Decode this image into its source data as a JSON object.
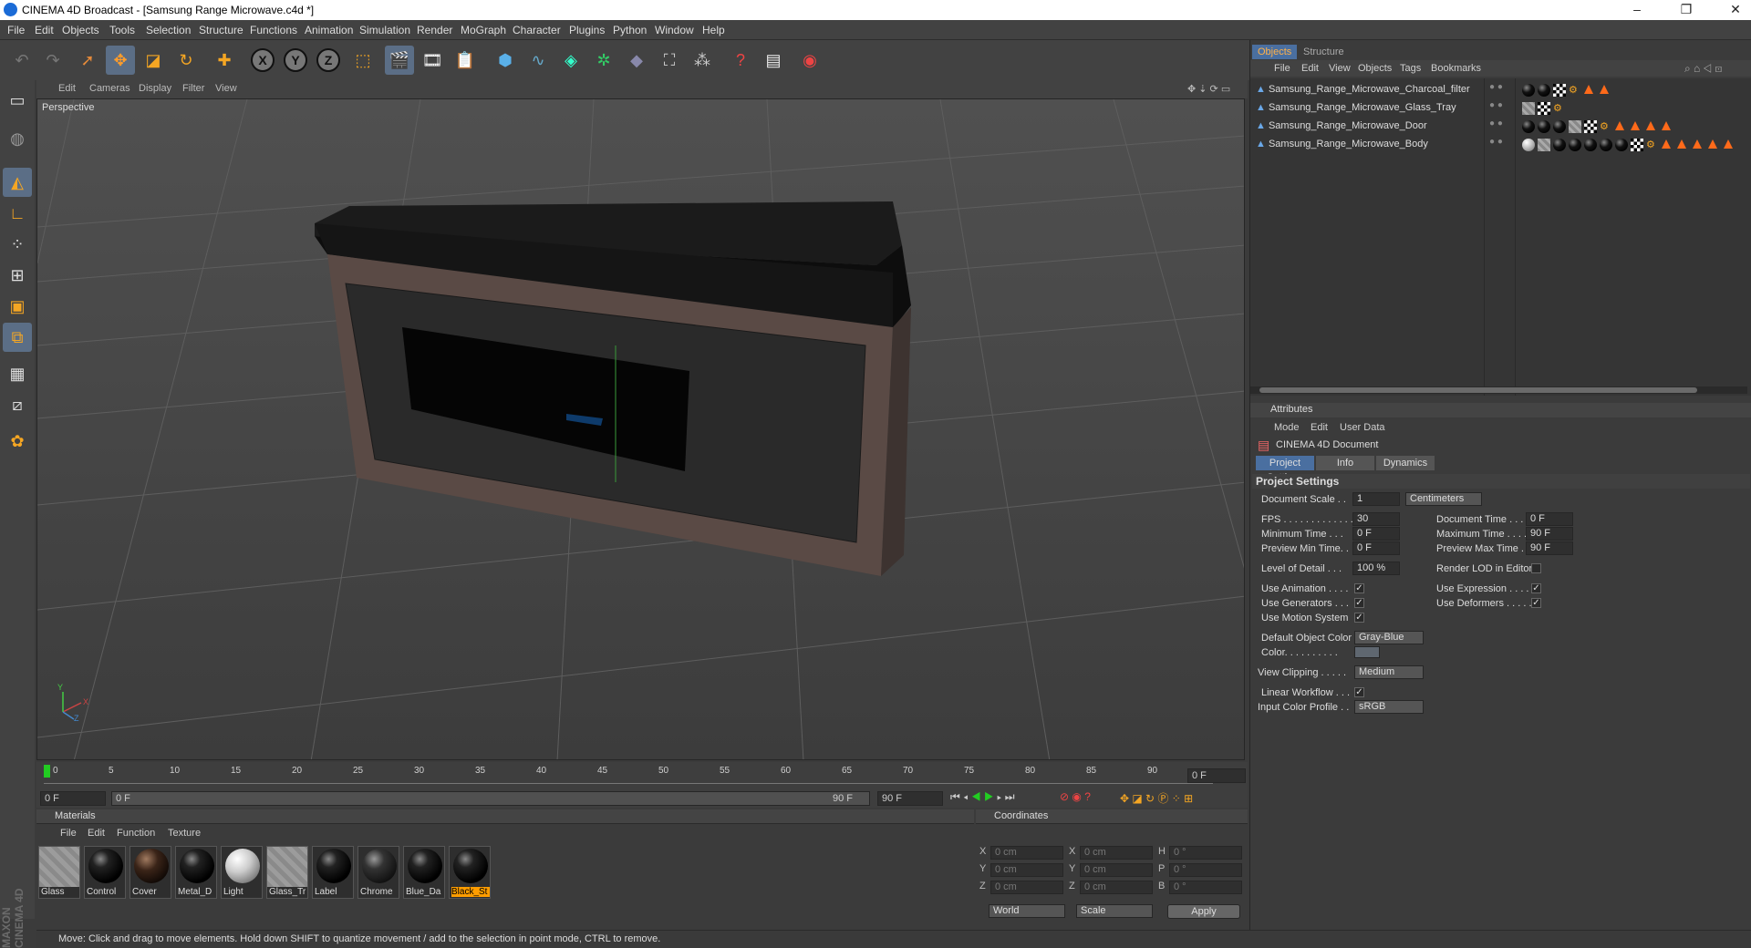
{
  "window": {
    "title": "CINEMA 4D Broadcast - [Samsung Range Microwave.c4d *]"
  },
  "menu": [
    "File",
    "Edit",
    "Objects",
    "Tools",
    "Selection",
    "Structure",
    "Functions",
    "Animation",
    "Simulation",
    "Render",
    "MoGraph",
    "Character",
    "Plugins",
    "Python",
    "Window",
    "Help"
  ],
  "viewport": {
    "menu": [
      "Edit",
      "Cameras",
      "Display",
      "Filter",
      "View"
    ],
    "label": "Perspective",
    "axis": {
      "x": "X",
      "y": "Y",
      "z": "Z"
    }
  },
  "timeline": {
    "ticks": [
      "0",
      "5",
      "10",
      "15",
      "20",
      "25",
      "30",
      "35",
      "40",
      "45",
      "50",
      "55",
      "60",
      "65",
      "70",
      "75",
      "80",
      "85",
      "90"
    ],
    "end_field": "0 F",
    "start": "0 F",
    "range_start": "0 F",
    "range_end": "90 F",
    "max": "90 F"
  },
  "materials": {
    "header": "Materials",
    "menu": [
      "File",
      "Edit",
      "Function",
      "Texture"
    ],
    "items": [
      {
        "label": "Glass",
        "kind": "stripes"
      },
      {
        "label": "Control",
        "kind": "black"
      },
      {
        "label": "Cover",
        "kind": "brown"
      },
      {
        "label": "Metal_D",
        "kind": "black"
      },
      {
        "label": "Light",
        "kind": "white"
      },
      {
        "label": "Glass_Tr",
        "kind": "stripes"
      },
      {
        "label": "Label",
        "kind": "black"
      },
      {
        "label": "Chrome",
        "kind": "dark"
      },
      {
        "label": "Blue_Da",
        "kind": "black"
      },
      {
        "label": "Black_St",
        "kind": "black",
        "selected": true
      }
    ]
  },
  "coordinates": {
    "header": "Coordinates",
    "rows": [
      {
        "a": "X",
        "av": "0 cm",
        "b": "X",
        "bv": "0 cm",
        "c": "H",
        "cv": "0 °"
      },
      {
        "a": "Y",
        "av": "0 cm",
        "b": "Y",
        "bv": "0 cm",
        "c": "P",
        "cv": "0 °"
      },
      {
        "a": "Z",
        "av": "0 cm",
        "b": "Z",
        "bv": "0 cm",
        "c": "B",
        "cv": "0 °"
      }
    ],
    "mode1": "World",
    "mode2": "Scale",
    "apply": "Apply"
  },
  "status": "Move: Click and drag to move elements. Hold down SHIFT to quantize movement / add to the selection in point mode, CTRL to remove.",
  "objects": {
    "tabs": [
      "Objects",
      "Structure"
    ],
    "menu": [
      "File",
      "Edit",
      "View",
      "Objects",
      "Tags",
      "Bookmarks"
    ],
    "items": [
      "Samsung_Range_Microwave_Charcoal_filter",
      "Samsung_Range_Microwave_Glass_Tray",
      "Samsung_Range_Microwave_Door",
      "Samsung_Range_Microwave_Body"
    ]
  },
  "attributes": {
    "header": "Attributes",
    "menu": [
      "Mode",
      "Edit",
      "User Data"
    ],
    "doc": "CINEMA 4D Document",
    "tabs": [
      "Project Settings",
      "Info",
      "Dynamics"
    ],
    "section": "Project Settings",
    "document_scale_label": "Document Scale . .",
    "document_scale": "1",
    "scale_unit": "Centimeters",
    "fps_label": "FPS . . . . . . . . . . . . .",
    "fps": "30",
    "doc_time_label": "Document Time . . . .",
    "doc_time": "0 F",
    "min_time_label": "Minimum Time . . .",
    "min_time": "0 F",
    "max_time_label": "Maximum Time . . . . .",
    "max_time": "90 F",
    "prev_min_label": "Preview Min Time. .",
    "prev_min": "0 F",
    "prev_max_label": "Preview Max Time . .",
    "prev_max": "90 F",
    "lod_label": "Level of Detail . . .",
    "lod": "100 %",
    "render_lod_label": "Render LOD in Editor",
    "use_anim_label": "Use Animation . . . .",
    "use_expr_label": "Use Expression . . . .",
    "use_gen_label": "Use Generators . . .",
    "use_def_label": "Use Deformers . . . . .",
    "use_motion_label": "Use Motion System",
    "def_color_label": "Default Object Color",
    "def_color": "Gray-Blue",
    "color_label": "Color. . . . . . . . . .",
    "clip_label": "View Clipping . . . . .",
    "clip": "Medium",
    "linear_label": "Linear Workflow . . .",
    "profile_label": "Input Color Profile . .",
    "profile": "sRGB"
  }
}
